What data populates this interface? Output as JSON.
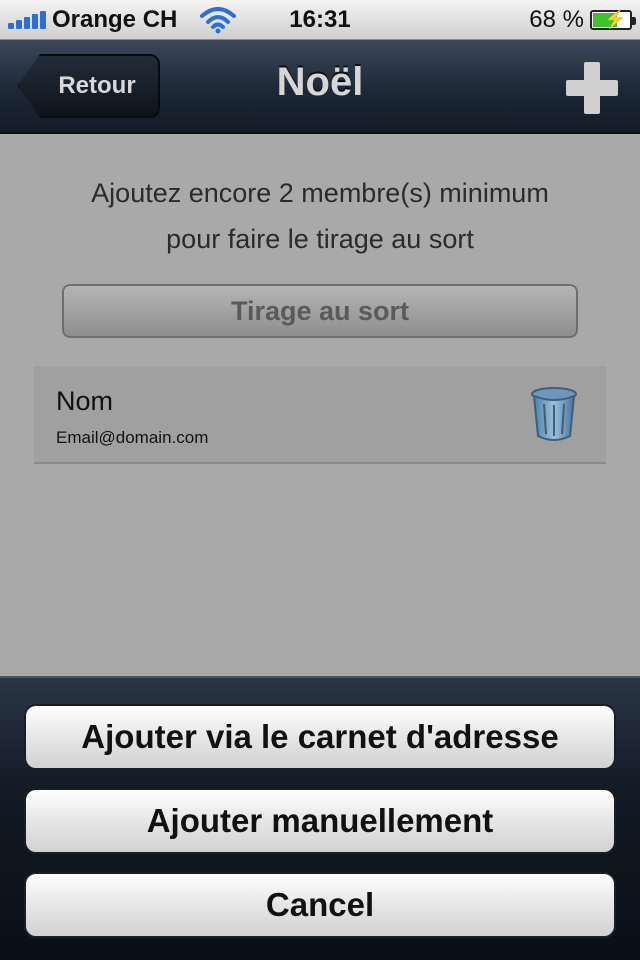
{
  "status_bar": {
    "carrier": "Orange CH",
    "time": "16:31",
    "battery_percent": "68 %",
    "battery_level": 0.68,
    "icons": [
      "signal-bars-icon",
      "wifi-icon",
      "battery-charging-icon"
    ]
  },
  "nav": {
    "back_label": "Retour",
    "title": "Noël",
    "add_icon": "plus-icon"
  },
  "main": {
    "info_line1": "Ajoutez encore 2 membre(s) minimum",
    "info_line2": "pour faire le tirage au sort",
    "draw_button_label": "Tirage au sort",
    "members": [
      {
        "name": "Nom",
        "email": "Email@domain.com",
        "delete_icon": "trash-icon"
      }
    ]
  },
  "action_sheet": {
    "buttons": [
      {
        "label": "Ajouter via le carnet d'adresse"
      },
      {
        "label": "Ajouter manuellement"
      },
      {
        "label": "Cancel"
      }
    ]
  },
  "colors": {
    "nav_dark": "#1d2836",
    "content_gray": "#a9a9a9",
    "battery_green": "#3fc12c",
    "signal_blue": "#2d6fd6"
  }
}
